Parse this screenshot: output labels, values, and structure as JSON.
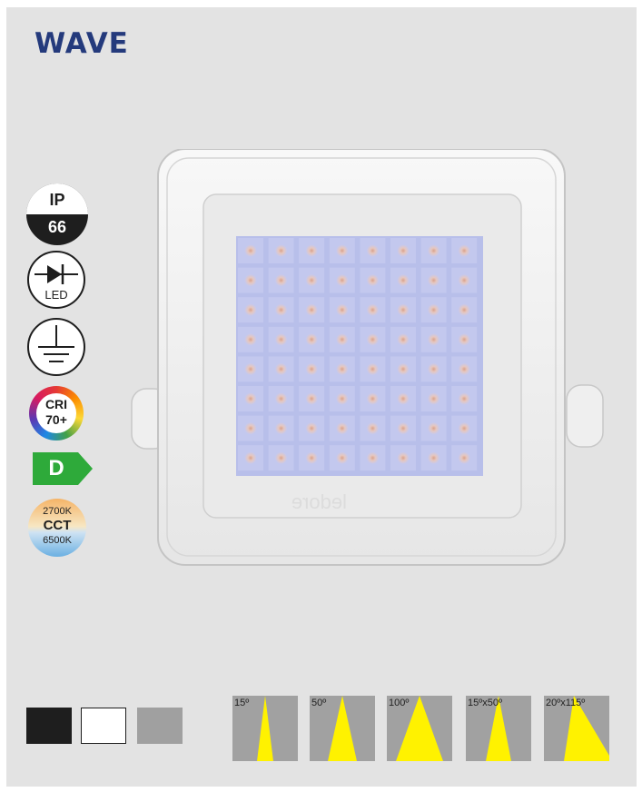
{
  "product": {
    "title": "WAVE",
    "body_color": "#f4f4f4",
    "led_color": "#b8bfea"
  },
  "badges": {
    "ip": {
      "top": "IP",
      "bottom": "66"
    },
    "led": {
      "label": "LED"
    },
    "ground": {
      "icon": "ground-icon"
    },
    "cri": {
      "line1": "CRI",
      "line2": "70+"
    },
    "energy_class": {
      "label": "D",
      "color": "#2eaa3a"
    },
    "cct": {
      "warm": "2700K",
      "label": "CCT",
      "cool": "6500K"
    }
  },
  "finishes": [
    {
      "name": "black",
      "color": "#1e1e1e"
    },
    {
      "name": "white",
      "color": "#ffffff"
    },
    {
      "name": "grey",
      "color": "#a0a0a0"
    }
  ],
  "beam_angles": [
    {
      "label": "15º",
      "beam_color": "#fff200"
    },
    {
      "label": "50º",
      "beam_color": "#fff200"
    },
    {
      "label": "100º",
      "beam_color": "#fff200"
    },
    {
      "label": "15ºx50º",
      "beam_color": "#fff200"
    },
    {
      "label": "20ºx115º",
      "beam_color": "#fff200"
    }
  ]
}
